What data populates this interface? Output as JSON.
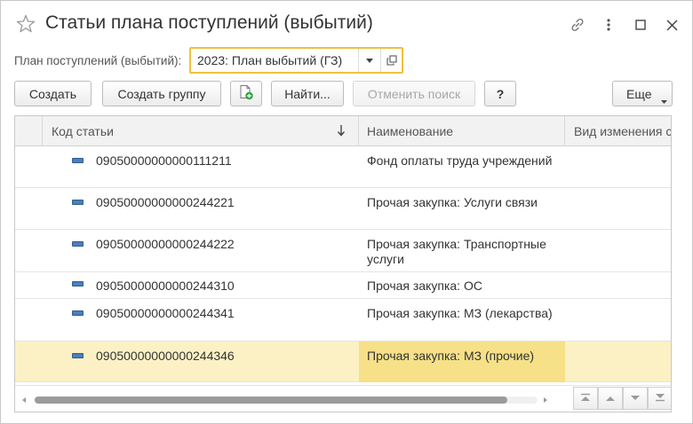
{
  "window": {
    "title": "Статьи плана поступлений (выбытий)"
  },
  "plan_selector": {
    "label": "План поступлений (выбытий):",
    "value": "2023: План выбытий (ГЗ)"
  },
  "toolbar": {
    "create_label": "Создать",
    "create_group_label": "Создать группу",
    "find_label": "Найти...",
    "cancel_search_label": "Отменить поиск",
    "help_label": "?",
    "more_label": "Еще"
  },
  "table": {
    "columns": {
      "code": "Код статьи",
      "name": "Наименование",
      "change_type": "Вид изменения с"
    },
    "rows": [
      {
        "code": "09050000000000111211",
        "name": "Фонд оплаты труда учреждений"
      },
      {
        "code": "09050000000000244221",
        "name": "Прочая закупка: Услуги связи"
      },
      {
        "code": "09050000000000244222",
        "name": "Прочая закупка: Транспортные услуги"
      },
      {
        "code": "09050000000000244310",
        "name": "Прочая закупка: ОС"
      },
      {
        "code": "09050000000000244341",
        "name": "Прочая закупка: МЗ (лекарства)"
      },
      {
        "code": "09050000000000244346",
        "name": "Прочая закупка: МЗ (прочие)"
      }
    ],
    "selected_row_index": 5,
    "horizontal_scroll_fraction": 0.94
  },
  "colors": {
    "focus_border": "#f0c13c",
    "selected_row": "#fbf1c4",
    "selected_cell": "#f6e088",
    "row_icon": "#4d7fb9"
  }
}
